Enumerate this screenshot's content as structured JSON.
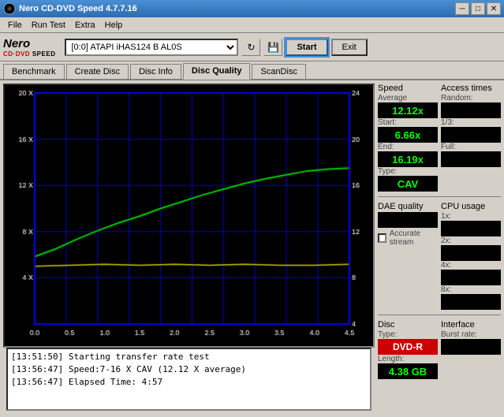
{
  "window": {
    "title": "Nero CD-DVD Speed 4.7.7.16"
  },
  "menu": {
    "items": [
      "File",
      "Run Test",
      "Extra",
      "Help"
    ]
  },
  "toolbar": {
    "drive_value": "[0:0]  ATAPI iHAS124  B AL0S",
    "start_label": "Start",
    "exit_label": "Exit"
  },
  "tabs": [
    {
      "id": "benchmark",
      "label": "Benchmark",
      "active": false
    },
    {
      "id": "create-disc",
      "label": "Create Disc",
      "active": false
    },
    {
      "id": "disc-info",
      "label": "Disc Info",
      "active": false
    },
    {
      "id": "disc-quality",
      "label": "Disc Quality",
      "active": true
    },
    {
      "id": "scan-disc",
      "label": "ScanDisc",
      "active": false
    }
  ],
  "speed_panel": {
    "title": "Speed",
    "average_label": "Average",
    "average_value": "12.12x",
    "start_label": "Start:",
    "start_value": "6.66x",
    "end_label": "End:",
    "end_value": "16.19x",
    "type_label": "Type:",
    "type_value": "CAV"
  },
  "access_times": {
    "title": "Access times",
    "random_label": "Random:",
    "onethird_label": "1/3:",
    "full_label": "Full:"
  },
  "dae_quality": {
    "title": "DAE quality",
    "accurate_stream_label": "Accurate stream"
  },
  "cpu_usage": {
    "title": "CPU usage",
    "labels": [
      "1x:",
      "2x:",
      "4x:",
      "8x:"
    ]
  },
  "disc_type": {
    "title": "Disc",
    "type_label": "Type:",
    "type_value": "DVD-R",
    "length_label": "Length:",
    "length_value": "4.38 GB"
  },
  "interface": {
    "title": "Interface",
    "burst_label": "Burst rate:"
  },
  "chart": {
    "x_labels": [
      "0.0",
      "0.5",
      "1.0",
      "1.5",
      "2.0",
      "2.5",
      "3.0",
      "3.5",
      "4.0",
      "4.5"
    ],
    "y_left_labels": [
      "4 X",
      "8 X",
      "12 X",
      "16 X",
      "20 X"
    ],
    "y_right_labels": [
      "4",
      "8",
      "12",
      "16",
      "20",
      "24"
    ]
  },
  "log": {
    "entries": [
      {
        "time": "[13:51:50]",
        "text": "Starting transfer rate test"
      },
      {
        "time": "[13:56:47]",
        "text": "Speed:7-16 X CAV (12.12 X average)"
      },
      {
        "time": "[13:56:47]",
        "text": "Elapsed Time: 4:57"
      }
    ]
  }
}
